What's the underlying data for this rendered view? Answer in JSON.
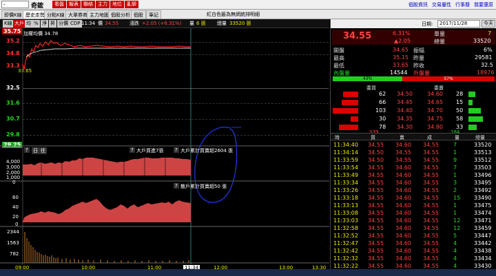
{
  "topbar": {
    "symbol": "-",
    "name": "奇鋐",
    "buttons": [
      "看盤",
      "報表",
      "聯絡",
      "主力",
      "地位",
      "亂聊"
    ],
    "links": [
      "個股資訊",
      "交易屬性",
      "行事曆",
      "我要還原"
    ]
  },
  "tabs": [
    "即價K線",
    "歷史走勢",
    "分點K線",
    "大單券商",
    "主力地圖",
    "個股分析",
    "個股",
    "筆記"
  ],
  "notice": "紅白色籤為無網統排明細",
  "chartbar": {
    "buttons": [
      "K線",
      "大戶",
      "均",
      "%",
      "淨",
      "昇",
      "分價",
      "CDP"
    ],
    "time": "11:34",
    "price_label": "價",
    "price": "34.55",
    "change_label": "漲跌",
    "change": "+2.05 (+6.31%)",
    "vol_label": "量",
    "vol": "6 張",
    "total_label": "總量",
    "total": "33520 張"
  },
  "yaxis": {
    "top": "35.75",
    "labels": [
      "35.2",
      "34.8",
      "33.3",
      "32.5",
      "31.6",
      "30.7",
      "29.8",
      "29.25"
    ]
  },
  "avg_label": "加權均價 34.78",
  "low_mark": "33.65",
  "sub1": {
    "labels": [
      "4,000",
      "3,000",
      "2,000",
      "1,000",
      "0"
    ],
    "buttons": [
      "?",
      "日",
      "往"
    ],
    "title1": "大戶買進7張",
    "title2": "大戶累計買賣超2604 張"
  },
  "sub2": {
    "labels": [
      "60",
      "40",
      "20",
      "0"
    ],
    "title": "散戶累計買賣超50 張"
  },
  "sub3": {
    "labels": [
      "2344",
      "1563",
      "782"
    ]
  },
  "xaxis": [
    "09:00",
    "10:00",
    "11:00",
    "11:34",
    "12:00",
    "13:00",
    "13:30"
  ],
  "right": {
    "date_label": "日期:",
    "date": "2017/11/28",
    "today": "今天",
    "price": "34.55",
    "pct": "6.31%",
    "chg": "▲2.05",
    "vol_label": "單量",
    "vol": "7",
    "tot_label": "總量",
    "tot": "33520",
    "stats": [
      {
        "l": "開盤",
        "v": "34.65",
        "l2": "振幅",
        "v2": "6%"
      },
      {
        "l": "最高",
        "v": "35.15",
        "l2": "昨量",
        "v2": "29581"
      },
      {
        "l": "最低",
        "v": "33.65",
        "l2": "昨收",
        "v2": "32.5"
      }
    ],
    "inner_label": "內盤量",
    "inner": "14544",
    "outer_label": "外盤量",
    "outer": "18976",
    "ratio_in": "43%",
    "ratio_out": "57%",
    "ob_head": [
      "委買",
      "委賣"
    ],
    "orderbook": [
      {
        "bq": "62",
        "bp": "34.50",
        "ap": "34.60",
        "aq": "28"
      },
      {
        "bq": "66",
        "bp": "34.45",
        "ap": "34.65",
        "aq": "15"
      },
      {
        "bq": "103",
        "bp": "34.40",
        "ap": "34.70",
        "aq": "50"
      },
      {
        "bq": "30",
        "bp": "34.35",
        "ap": "34.75",
        "aq": "58"
      },
      {
        "bq": "78",
        "bp": "34.30",
        "ap": "34.80",
        "aq": "33"
      }
    ],
    "ob_totals": {
      "buy": "339",
      "sell": "184"
    },
    "tick_head": [
      "時",
      "買",
      "賣",
      "成",
      "量",
      "總量"
    ],
    "ticks": [
      {
        "t": "11:34:40",
        "b": "34.55",
        "s": "34.60",
        "p": "34.55",
        "q": "7",
        "tot": "33520"
      },
      {
        "t": "11:34:14",
        "b": "34.50",
        "s": "34.55",
        "p": "34.55",
        "q": "1",
        "tot": "33513"
      },
      {
        "t": "11:33:59",
        "b": "34.50",
        "s": "34.55",
        "p": "34.55",
        "q": "9",
        "tot": "33512"
      },
      {
        "t": "11:33:54",
        "b": "34.55",
        "s": "34.60",
        "p": "34.55",
        "q": "7",
        "tot": "33503"
      },
      {
        "t": "11:33:49",
        "b": "34.55",
        "s": "34.60",
        "p": "34.55",
        "q": "1",
        "tot": "33496"
      },
      {
        "t": "11:33:34",
        "b": "34.55",
        "s": "34.60",
        "p": "34.55",
        "q": "3",
        "tot": "33495"
      },
      {
        "t": "11:33:26",
        "b": "34.55",
        "s": "34.60",
        "p": "34.55",
        "q": "2",
        "tot": "33492"
      },
      {
        "t": "11:33:18",
        "b": "34.55",
        "s": "34.60",
        "p": "34.55",
        "q": "15",
        "tot": "33490"
      },
      {
        "t": "11:33:13",
        "b": "34.55",
        "s": "34.60",
        "p": "34.55",
        "q": "1",
        "tot": "33475"
      },
      {
        "t": "11:33:08",
        "b": "34.55",
        "s": "34.60",
        "p": "34.55",
        "q": "1",
        "tot": "33474"
      },
      {
        "t": "11:33:03",
        "b": "34.55",
        "s": "34.60",
        "p": "34.55",
        "q": "12",
        "tot": "33471"
      },
      {
        "t": "11:32:58",
        "b": "34.55",
        "s": "34.60",
        "p": "34.55",
        "q": "12",
        "tot": "33459"
      },
      {
        "t": "11:32:52",
        "b": "34.55",
        "s": "34.60",
        "p": "34.55",
        "q": "5",
        "tot": "33447"
      },
      {
        "t": "11:32:47",
        "b": "34.55",
        "s": "34.60",
        "p": "34.55",
        "q": "4",
        "tot": "33442"
      },
      {
        "t": "11:32:42",
        "b": "34.55",
        "s": "34.60",
        "p": "34.55",
        "q": "4",
        "tot": "33438"
      },
      {
        "t": "11:32:32",
        "b": "34.55",
        "s": "34.60",
        "p": "34.55",
        "q": "4",
        "tot": "33434"
      },
      {
        "t": "11:32:22",
        "b": "34.55",
        "s": "34.60",
        "p": "34.55",
        "q": "4",
        "tot": "33430"
      }
    ]
  },
  "colors": {
    "up": "#f44",
    "down": "#2d2",
    "avg": "#fff",
    "flat": "#ee0"
  }
}
